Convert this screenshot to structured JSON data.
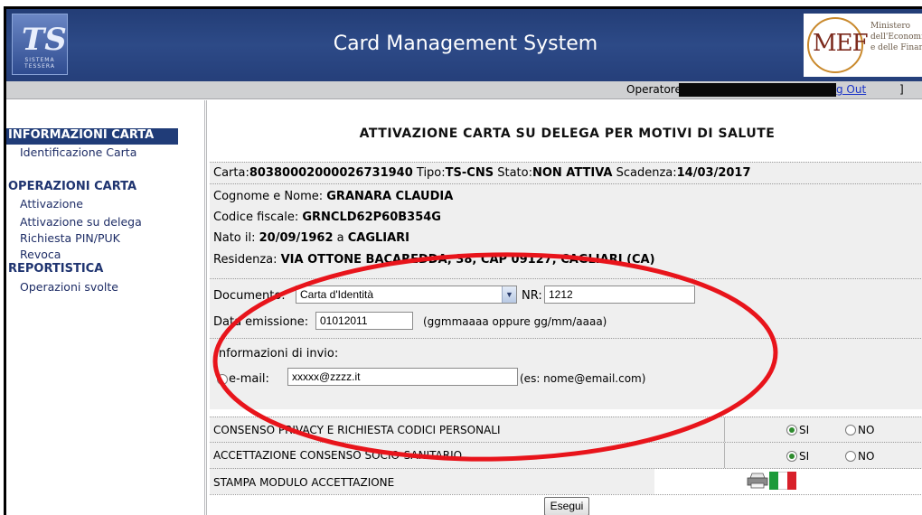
{
  "header": {
    "title": "Card Management System",
    "ts_logo_letters": "TS",
    "ts_logo_sub": "SISTEMA TESSERA",
    "mef_logo_text": "MEF",
    "mef_lines": [
      "Ministero",
      "dell'Economia",
      "e delle Finanze"
    ]
  },
  "operator_bar": {
    "label": "Operatore:",
    "logout_label": "g Out",
    "closing_bracket": "]"
  },
  "sidebar": {
    "section1": "INFORMAZIONI CARTA",
    "item_identificazione": "Identificazione Carta",
    "section2": "OPERAZIONI CARTA",
    "item_attivazione": "Attivazione",
    "item_attivazione_delega": "Attivazione su delega",
    "item_richiesta": "Richiesta PIN/PUK",
    "item_revoca": "Revoca",
    "section3": "REPORTISTICA",
    "item_operazioni": "Operazioni svolte"
  },
  "main": {
    "title": "ATTIVAZIONE CARTA SU DELEGA PER MOTIVI DI SALUTE",
    "card": {
      "carta_label": "Carta:",
      "carta_value": "80380002000026731940",
      "tipo_label": "Tipo:",
      "tipo_value": "TS-CNS",
      "stato_label": "Stato:",
      "stato_value": "NON ATTIVA",
      "scadenza_label": "Scadenza:",
      "scadenza_value": "14/03/2017"
    },
    "person": {
      "nome_label": "Cognome e Nome: ",
      "nome_value": "GRANARA CLAUDIA",
      "cf_label": "Codice fiscale: ",
      "cf_value": "GRNCLD62P60B354G",
      "nato_label": "Nato il: ",
      "nato_date": "20/09/1962",
      "nato_a": " a ",
      "nato_city": "CAGLIARI",
      "residenza_label": "Residenza: ",
      "residenza_value": "VIA OTTONE BACAREDDA, 38, CAP 09127, CAGLIARI (CA)"
    },
    "document": {
      "documento_label": "Documento:",
      "documento_value": "Carta d'Identità",
      "nr_label": "NR:",
      "nr_value": "1212",
      "data_label": "Data emissione:",
      "data_value": "01012011",
      "data_hint": "(ggmmaaaa oppure gg/mm/aaaa)",
      "info_label": "Informazioni di invio:",
      "email_label": "e-mail:",
      "email_value": "xxxxx@zzzz.it",
      "email_hint": "(es: nome@email.com)"
    },
    "consents": [
      {
        "label": "CONSENSO PRIVACY E RICHIESTA CODICI PERSONALI",
        "si": "SI",
        "no": "NO",
        "selected": "SI"
      },
      {
        "label": "ACCETTAZIONE CONSENSO SOCIO-SANITARIO",
        "si": "SI",
        "no": "NO",
        "selected": "SI"
      }
    ],
    "stampa_label": "STAMPA MODULO ACCETTAZIONE",
    "esegui_label": "Esegui"
  },
  "colors": {
    "header_blue": "#2d4a87",
    "highlight_red": "#e8141b",
    "row_gray": "#efefef"
  },
  "icons": [
    "ts-logo-icon",
    "mef-logo-icon",
    "printer-icon",
    "italy-flag-icon",
    "chevron-down-icon"
  ]
}
